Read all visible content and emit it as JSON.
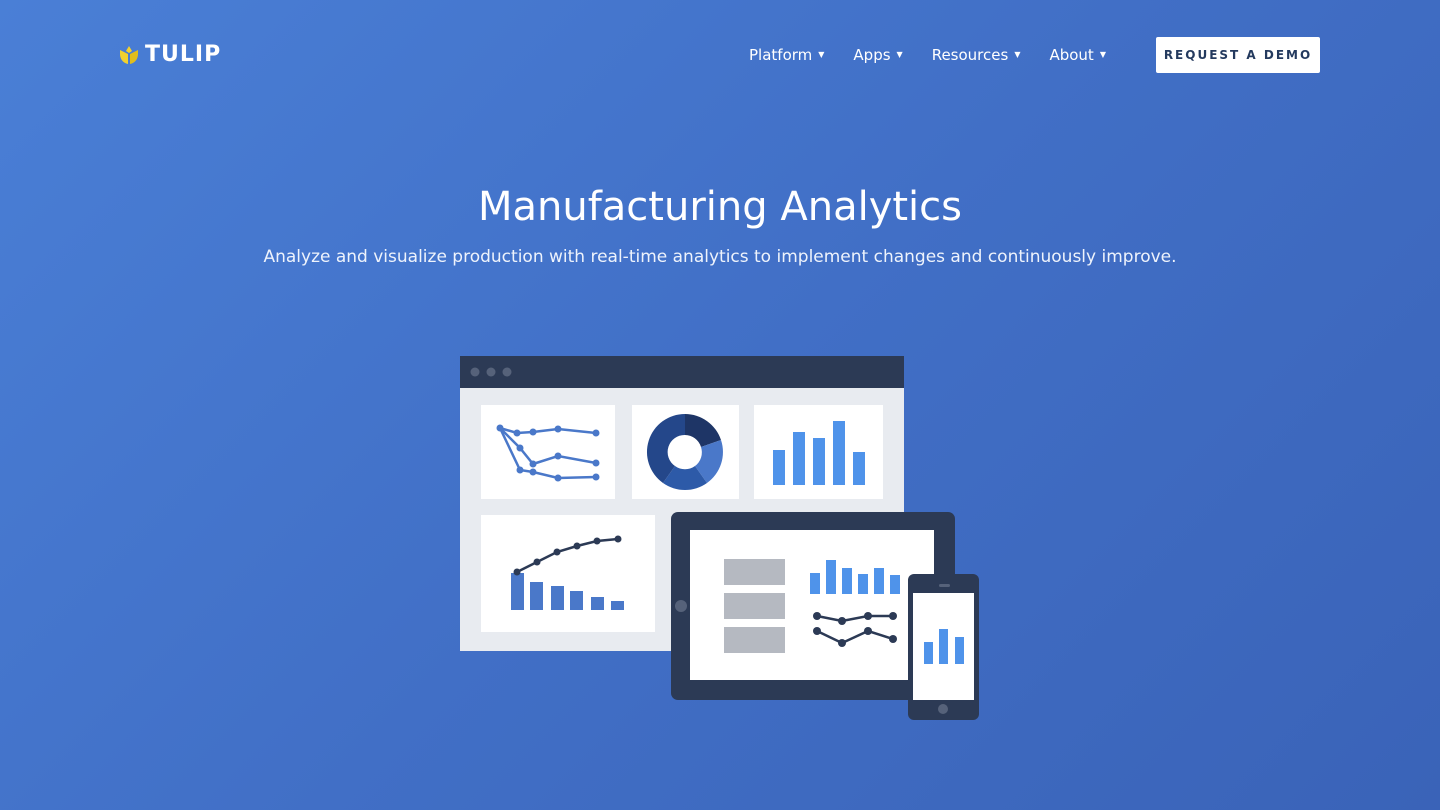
{
  "brand": {
    "name": "TULIP",
    "logo_icon": "tulip-icon",
    "logo_color": "#f2d12e"
  },
  "nav": {
    "items": [
      {
        "label": "Platform",
        "icon": "chevron-down-icon"
      },
      {
        "label": "Apps",
        "icon": "chevron-down-icon"
      },
      {
        "label": "Resources",
        "icon": "chevron-down-icon"
      },
      {
        "label": "About",
        "icon": "chevron-down-icon"
      }
    ],
    "cta_label": "REQUEST A DEMO"
  },
  "hero": {
    "title": "Manufacturing Analytics",
    "subtitle": "Analyze and visualize production with real-time analytics to implement changes and continuously improve."
  },
  "colors": {
    "background": "#4477cf",
    "dark_frame": "#2c3a55",
    "chart_blue": "#4f93ea",
    "chart_mid": "#4a78c9",
    "chart_navy": "#1e3566"
  },
  "illustration": {
    "name": "dashboard-devices-illustration",
    "devices": [
      "browser-window",
      "tablet",
      "phone"
    ]
  }
}
